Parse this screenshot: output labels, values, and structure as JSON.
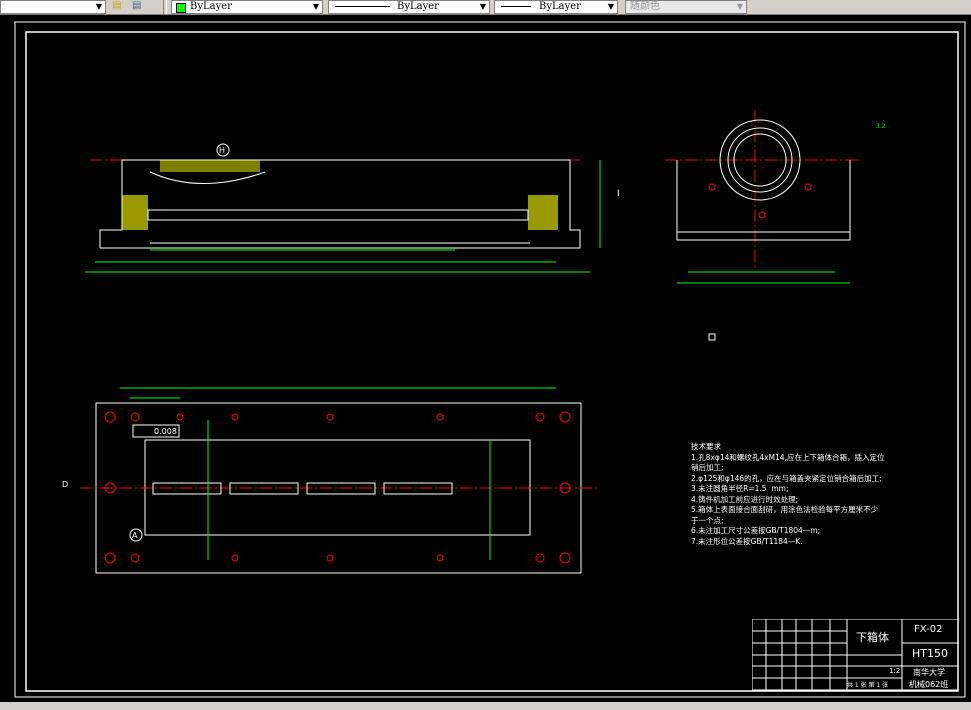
{
  "toolbar": {
    "layer_color": "ByLayer",
    "linetype": "ByLayer",
    "lineweight": "ByLayer",
    "plot_color": "随颜色",
    "color_swatch": "#00ff00"
  },
  "drawing": {
    "labels": {
      "view_h": "H",
      "datum_a": "A",
      "section_d": "D",
      "tolerance": "0.008",
      "section_i": "I",
      "roughness": "3.2"
    },
    "technical_requirements": {
      "title": "技术要求",
      "items": [
        "1.孔8xφ14和螺纹孔4xM14,应在上下箱体合箱，插入定位",
        "销后加工;",
        "2.φ125和φ146的孔，应在与箱盖夹紧定位销合箱后加工;",
        "3.未注圆角半径R=1.5  mm;",
        "4.铸件机加工前应进行时效处理;",
        "5.箱体上表面接合面刮研，用涂色法检验每平方厘米不少",
        "于一个点;",
        "6.未注加工尺寸公差按GB/T1804—m;",
        "7.未注形位公差按GB/T1184—K."
      ]
    },
    "title_block": {
      "part_name": "下箱体",
      "drawing_no": "FX-02",
      "material": "HT150",
      "scale": "1:2",
      "sheets": "共 1 张  第 1 张",
      "school": "南华大学",
      "class": "机械062班"
    },
    "colors": {
      "outline": "#ffffff",
      "dimension": "#00ff00",
      "centerline": "#ff0000",
      "hatch": "#ffff00",
      "annotation": "#00ffff"
    }
  }
}
